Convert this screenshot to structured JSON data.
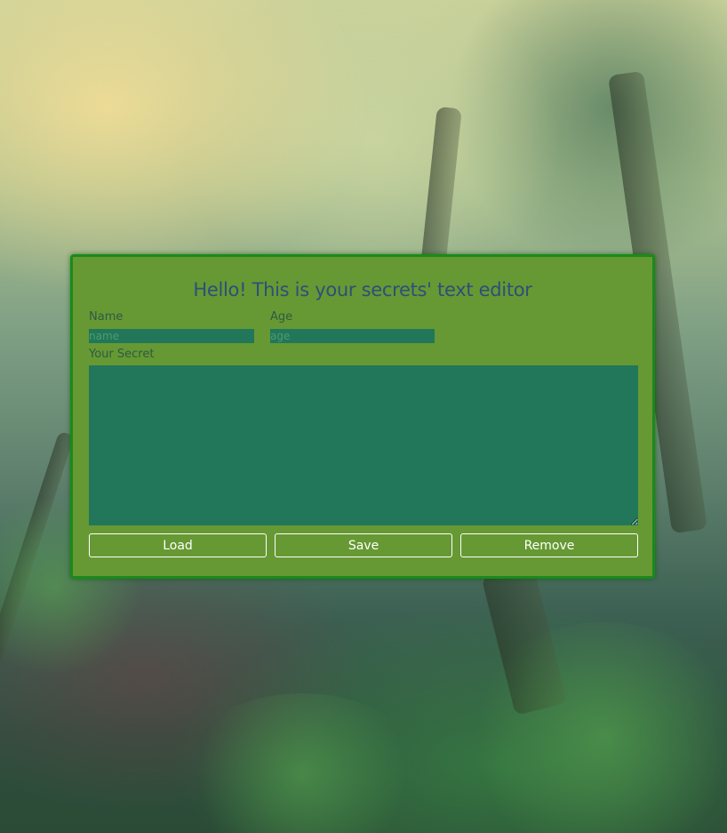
{
  "colors": {
    "panel_bg": "#669933",
    "panel_border": "#1a8a1a",
    "field_bg": "#22775a",
    "title_color": "#2d4f7a",
    "button_border": "#ffffff"
  },
  "editor": {
    "title": "Hello! This is your secrets' text editor",
    "name_label": "Name",
    "name_placeholder": "name",
    "name_value": "",
    "age_label": "Age",
    "age_placeholder": "age",
    "age_value": "",
    "secret_label": "Your Secret",
    "secret_value": ""
  },
  "buttons": {
    "load": "Load",
    "save": "Save",
    "remove": "Remove"
  }
}
